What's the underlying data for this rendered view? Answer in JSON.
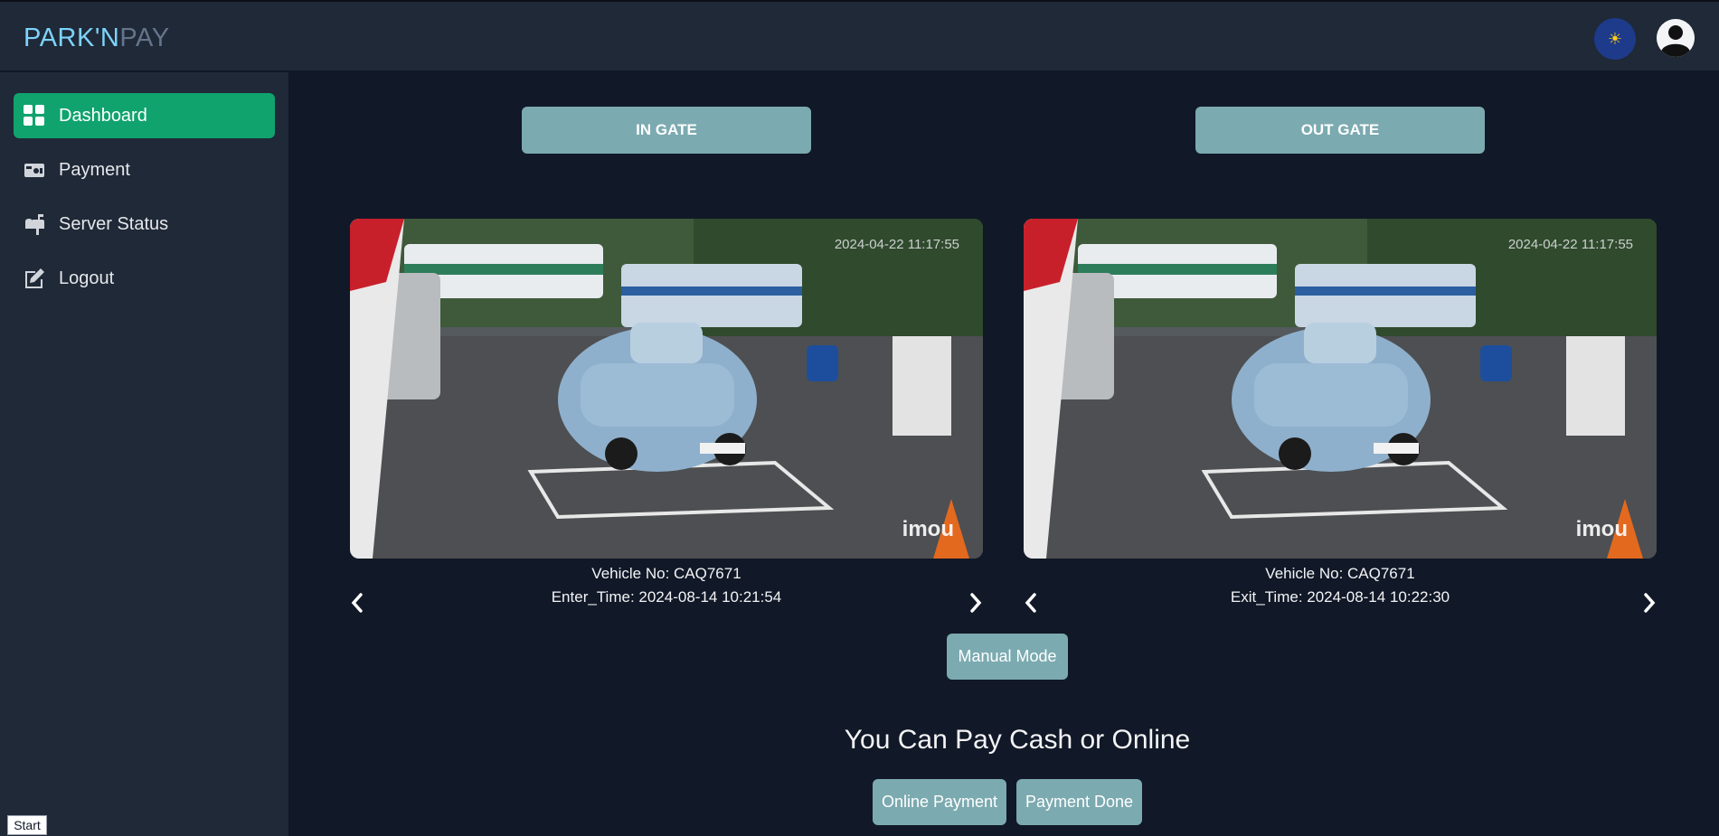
{
  "app": {
    "logo_part1": "PARK'N",
    "logo_part2": "PAY",
    "theme_icon": "sun-icon",
    "avatar_icon": "user-avatar-icon"
  },
  "sidebar": {
    "items": [
      {
        "label": "Dashboard",
        "icon": "dashboard-grid-icon",
        "active": true
      },
      {
        "label": "Payment",
        "icon": "payment-icon",
        "active": false
      },
      {
        "label": "Server Status",
        "icon": "mailbox-icon",
        "active": false
      },
      {
        "label": "Logout",
        "icon": "edit-icon",
        "active": false
      }
    ]
  },
  "gates": {
    "in_label": "IN GATE",
    "out_label": "OUT GATE"
  },
  "cameras": {
    "in": {
      "overlay_timestamp": "2024-04-22 11:17:55",
      "watermark": "imou",
      "vehicle_line": "Vehicle No: CAQ7671",
      "time_line": "Enter_Time: 2024-08-14 10:21:54"
    },
    "out": {
      "overlay_timestamp": "2024-04-22 11:17:55",
      "watermark": "imou",
      "vehicle_line": "Vehicle No: CAQ7671",
      "time_line": "Exit_Time: 2024-08-14 10:22:30"
    }
  },
  "actions": {
    "manual_mode": "Manual Mode",
    "pay_title": "You Can Pay Cash or Online",
    "online_payment": "Online Payment",
    "payment_done": "Payment Done"
  },
  "taskbar": {
    "start": "Start"
  },
  "colors": {
    "accent_green": "#10a36e",
    "button_teal": "#7baab0",
    "logo_blue": "#7dd3fc",
    "background": "#111827",
    "panel": "#1f2937"
  }
}
